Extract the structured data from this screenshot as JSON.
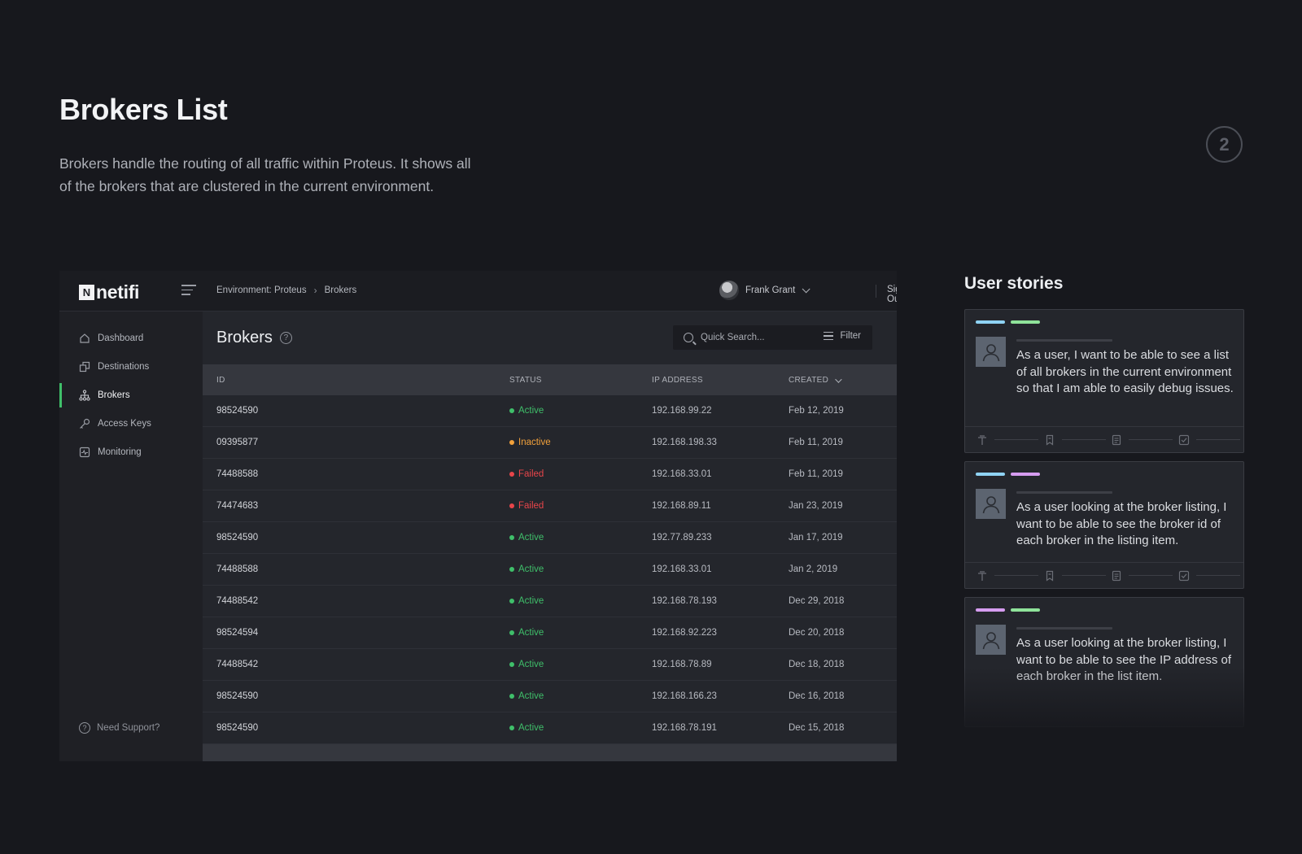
{
  "page": {
    "title": "Brokers List",
    "description": "Brokers handle the routing of all traffic within Proteus. It shows all of the brokers that are clustered in the current environment.",
    "step": "2"
  },
  "app": {
    "logo_mark": "N",
    "logo_text": "netifi",
    "breadcrumb": [
      "Environment: Proteus",
      "Brokers"
    ],
    "user_name": "Frank Grant",
    "sign_out": "Sign Out"
  },
  "sidebar": {
    "items": [
      {
        "label": "Dashboard",
        "icon": "home-icon"
      },
      {
        "label": "Destinations",
        "icon": "destinations-icon"
      },
      {
        "label": "Brokers",
        "icon": "network-icon",
        "active": true
      },
      {
        "label": "Access Keys",
        "icon": "key-icon"
      },
      {
        "label": "Monitoring",
        "icon": "monitor-icon"
      }
    ],
    "support": "Need Support?"
  },
  "main": {
    "title": "Brokers",
    "search_placeholder": "Quick Search...",
    "filter_label": "Filter"
  },
  "table": {
    "columns": [
      "ID",
      "STATUS",
      "IP ADDRESS",
      "CREATED"
    ],
    "rows": [
      {
        "id": "98524590",
        "status": "Active",
        "ip": "192.168.99.22",
        "created": "Feb 12, 2019"
      },
      {
        "id": "09395877",
        "status": "Inactive",
        "ip": "192.168.198.33",
        "created": "Feb 11, 2019"
      },
      {
        "id": "74488588",
        "status": "Failed",
        "ip": "192.168.33.01",
        "created": "Feb 11, 2019"
      },
      {
        "id": "74474683",
        "status": "Failed",
        "ip": "192.168.89.11",
        "created": "Jan 23, 2019"
      },
      {
        "id": "98524590",
        "status": "Active",
        "ip": "192.77.89.233",
        "created": "Jan 17, 2019"
      },
      {
        "id": "74488588",
        "status": "Active",
        "ip": "192.168.33.01",
        "created": "Jan 2, 2019"
      },
      {
        "id": "74488542",
        "status": "Active",
        "ip": "192.168.78.193",
        "created": "Dec 29, 2018"
      },
      {
        "id": "98524594",
        "status": "Active",
        "ip": "192.168.92.223",
        "created": "Dec 20, 2018"
      },
      {
        "id": "74488542",
        "status": "Active",
        "ip": "192.168.78.89",
        "created": "Dec 18, 2018"
      },
      {
        "id": "98524590",
        "status": "Active",
        "ip": "192.168.166.23",
        "created": "Dec 16, 2018"
      },
      {
        "id": "98524590",
        "status": "Active",
        "ip": "192.168.78.191",
        "created": "Dec 15, 2018"
      }
    ]
  },
  "status_colors": {
    "Active": "#3fbf6a",
    "Inactive": "#f2a13b",
    "Failed": "#e8454a"
  },
  "stories": {
    "title": "User stories",
    "cards": [
      {
        "tags": [
          "#8fd3f4",
          "#8fe39a"
        ],
        "text": "As a user, I want to be able to see a list of all brokers in the current environment so that I am able to easily debug issues."
      },
      {
        "tags": [
          "#8fd3f4",
          "#d69cf0"
        ],
        "text": "As a user looking at the broker listing, I want to be able to see the broker id of each broker in the listing item."
      },
      {
        "tags": [
          "#d69cf0",
          "#8fe39a"
        ],
        "text": "As a user looking at the broker listing, I want to be able to see the IP address of each broker in the list item."
      }
    ]
  }
}
